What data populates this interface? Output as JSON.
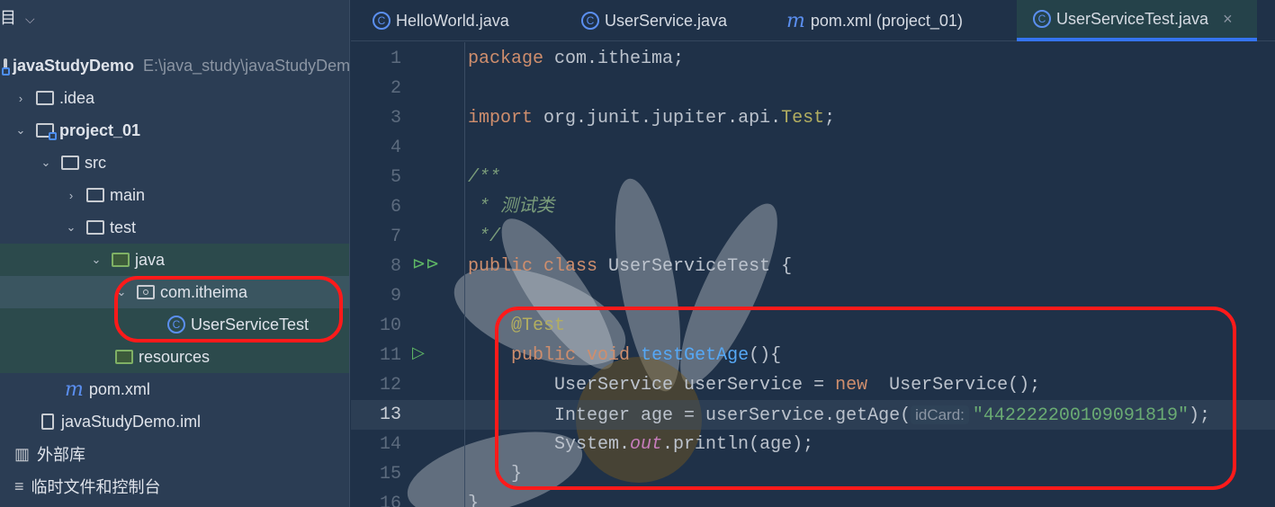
{
  "sidebar": {
    "title": "目",
    "rows": [
      {
        "label": "javaStudyDemo",
        "path": "E:\\java_study\\javaStudyDemo"
      },
      {
        "label": ".idea"
      },
      {
        "label": "project_01"
      },
      {
        "label": "src"
      },
      {
        "label": "main"
      },
      {
        "label": "test"
      },
      {
        "label": "java"
      },
      {
        "label": "com.itheima"
      },
      {
        "label": "UserServiceTest"
      },
      {
        "label": "resources"
      },
      {
        "label": "pom.xml"
      },
      {
        "label": "javaStudyDemo.iml"
      },
      {
        "label": "外部库"
      },
      {
        "label": "临时文件和控制台"
      }
    ]
  },
  "tabs": [
    {
      "label": "HelloWorld.java",
      "icon": "class-icon"
    },
    {
      "label": "UserService.java",
      "icon": "class-icon"
    },
    {
      "label": "pom.xml (project_01)",
      "icon": "maven-icon"
    },
    {
      "label": "UserServiceTest.java",
      "icon": "test-class-icon",
      "active": true,
      "close": "×"
    }
  ],
  "editor": {
    "lines": [
      {
        "n": "1",
        "t": [
          [
            "kw",
            "package"
          ],
          [
            "",
            "com.itheima;"
          ]
        ]
      },
      {
        "n": "2",
        "t": []
      },
      {
        "n": "3",
        "t": [
          [
            "kw",
            "import"
          ],
          [
            "",
            "org.junit.jupiter.api."
          ],
          [
            "imp",
            "Test"
          ],
          [
            "",
            ";"
          ]
        ]
      },
      {
        "n": "4",
        "t": []
      },
      {
        "n": "5",
        "t": [
          [
            "cm",
            "/**"
          ]
        ]
      },
      {
        "n": "6",
        "t": [
          [
            "cm",
            " * 测试类"
          ]
        ]
      },
      {
        "n": "7",
        "t": [
          [
            "cm",
            " */"
          ]
        ]
      },
      {
        "n": "8",
        "t": [
          [
            "kw",
            "public class"
          ],
          [
            "",
            "UserServiceTest {"
          ]
        ]
      },
      {
        "n": "9",
        "t": []
      },
      {
        "n": "10",
        "t": [
          [
            "",
            "    "
          ],
          [
            "ann",
            "@Test"
          ]
        ]
      },
      {
        "n": "11",
        "t": [
          [
            "",
            "    "
          ],
          [
            "kw",
            "public void"
          ],
          [
            "fn",
            "testGetAge"
          ],
          [
            "",
            "(){"
          ]
        ]
      },
      {
        "n": "12",
        "t": [
          [
            "",
            "        UserService userService = "
          ],
          [
            "kw",
            "new"
          ],
          [
            "",
            " UserService();"
          ]
        ]
      },
      {
        "n": "13",
        "t": [
          [
            "",
            "        Integer age = userService.getAge("
          ],
          [
            "hint",
            "idCard:"
          ],
          [
            "str",
            "\"442222200109091819\""
          ],
          [
            "",
            ");"
          ]
        ]
      },
      {
        "n": "14",
        "t": [
          [
            "",
            "        System."
          ],
          [
            "st",
            "out"
          ],
          [
            "",
            ".println(age);"
          ]
        ]
      },
      {
        "n": "15",
        "t": [
          [
            "",
            "    }"
          ]
        ]
      },
      {
        "n": "16",
        "t": [
          [
            "",
            "}"
          ]
        ]
      }
    ]
  }
}
